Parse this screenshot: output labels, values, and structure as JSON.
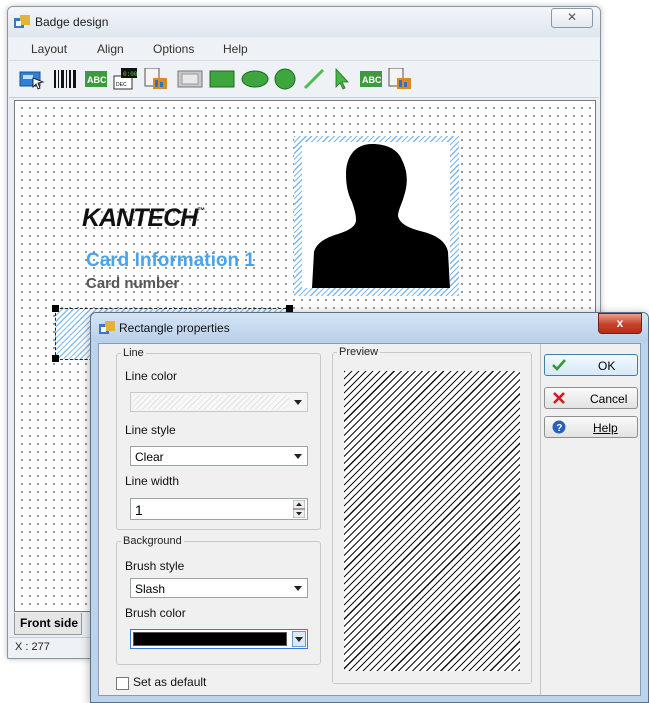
{
  "main_window": {
    "title": "Badge design",
    "close_symbol": "✕",
    "menu": [
      "Layout",
      "Align",
      "Options",
      "Help"
    ],
    "toolbar_icons": [
      "pointer-tool-icon",
      "barcode-icon",
      "text-abc-icon",
      "date-text-icon",
      "image-icon",
      "picture-frame-icon",
      "rectangle-icon",
      "ellipse-icon",
      "circle-icon",
      "line-icon",
      "select-arrow-icon",
      "text-abc-icon-2",
      "logo-image-icon"
    ],
    "badge": {
      "logo_text": "KANTECH",
      "logo_tm": "™",
      "card_information": "Card Information 1",
      "card_number": "Card number"
    },
    "tab_front": "Front side",
    "status_x": "X : 277"
  },
  "dialog": {
    "title": "Rectangle properties",
    "close_symbol": "x",
    "line_group": "Line",
    "line_color_label": "Line color",
    "line_style_label": "Line style",
    "line_style_value": "Clear",
    "line_width_label": "Line width",
    "line_width_value": "1",
    "background_group": "Background",
    "brush_style_label": "Brush style",
    "brush_style_value": "Slash",
    "brush_color_label": "Brush color",
    "brush_color_value": "#000000",
    "preview_label": "Preview",
    "set_default_label": "Set as default",
    "set_default_checked": false,
    "ok_label": "OK",
    "cancel_label": "Cancel",
    "help_label": "Help",
    "colors": {
      "ok_check": "#2e9c2e",
      "cancel_x": "#d11a1a",
      "help_icon": "#2a5fc0"
    }
  }
}
